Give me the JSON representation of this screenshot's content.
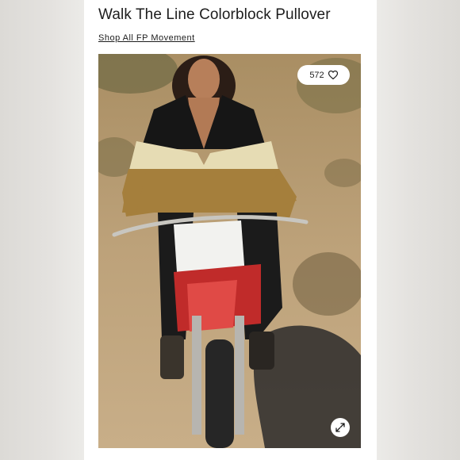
{
  "product": {
    "title": "Walk The Line Colorblock Pullover",
    "shop_link": "Shop All FP Movement"
  },
  "image": {
    "like_count": "572",
    "like_icon": "heart-icon",
    "expand_icon": "expand-icon"
  }
}
